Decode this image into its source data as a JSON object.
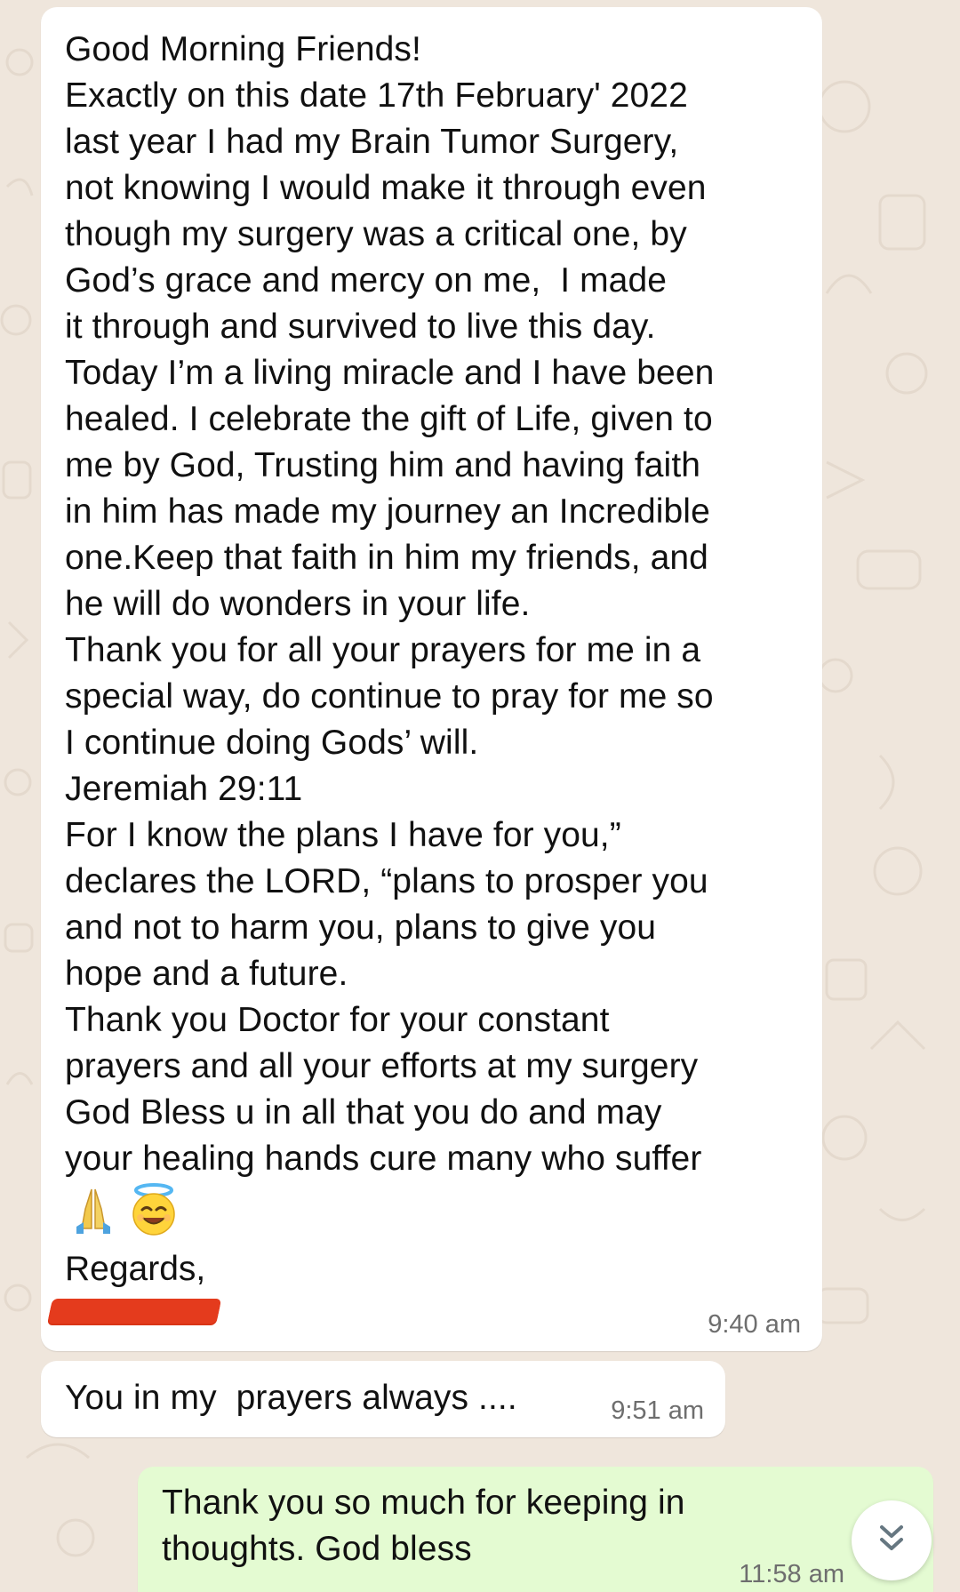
{
  "colors": {
    "chat_background": "#efe6dc",
    "incoming_bubble": "#ffffff",
    "outgoing_bubble": "#e4fbd2",
    "timestamp": "#6e6e6e",
    "redaction": "#e43b1d"
  },
  "messages": [
    {
      "direction": "incoming",
      "text": "Good Morning Friends!\nExactly on this date 17th February' 2022\nlast year I had my Brain Tumor Surgery,\nnot knowing I would make it through even\nthough my surgery was a critical one, by\nGod’s grace and mercy on me,  I made\nit through and survived to live this day.\nToday I’m a living miracle and I have been\nhealed. I celebrate the gift of Life, given to\nme by God, Trusting him and having faith\nin him has made my journey an Incredible\none.Keep that faith in him my friends, and\nhe will do wonders in your life.\nThank you for all your prayers for me in a\nspecial way, do continue to pray for me so\nI continue doing Gods’ will.\nJeremiah 29:11\nFor I know the plans I have for you,”\ndeclares the LORD, “plans to prosper you\nand not to harm you, plans to give you\nhope and a future.\nThank you Doctor for your constant\nprayers and all your efforts at my surgery\nGod Bless u in all that you do and may\nyour healing hands cure many who suffer",
      "emoji": [
        "folded-hands",
        "smiling-face-with-halo"
      ],
      "closing": "Regards,",
      "signature_redacted": true,
      "time": "9:40 am"
    },
    {
      "direction": "incoming",
      "text": "You in my  prayers always ....",
      "time": "9:51 am"
    },
    {
      "direction": "outgoing",
      "text": "Thank you so much for keeping in\nthoughts. God bless",
      "time": "11:58 am"
    }
  ],
  "scroll_button": {
    "icon": "double-chevron-down-icon"
  }
}
